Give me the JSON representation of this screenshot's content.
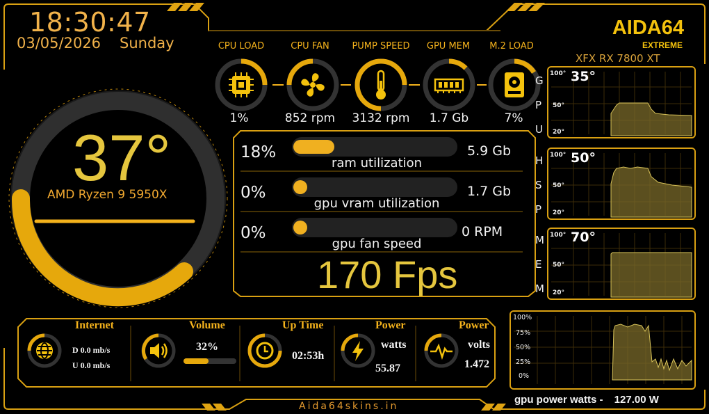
{
  "header": {
    "time": "18:30:47",
    "date": "03/05/2026",
    "day": "Sunday",
    "brand": "AIDA64",
    "brand_sub": "EXTREME",
    "gpu_name": "XFX RX 7800 XT"
  },
  "cpu": {
    "temp": "37°",
    "name": "AMD Ryzen 9 5950X",
    "ring_fraction": 0.55
  },
  "gauges": [
    {
      "label": "CPU LOAD",
      "value": "1%",
      "icon": "cpu-chip-icon",
      "fraction": 0.05
    },
    {
      "label": "CPU FAN",
      "value": "852 rpm",
      "icon": "fan-icon",
      "fraction": 0.25
    },
    {
      "label": "PUMP SPEED",
      "value": "3132 rpm",
      "icon": "thermometer-icon",
      "fraction": 0.75
    },
    {
      "label": "GPU MEM",
      "value": "1.7 Gb",
      "icon": "memory-module-icon",
      "fraction": 0.12
    },
    {
      "label": "M.2 LOAD",
      "value": "7%",
      "icon": "hard-drive-icon",
      "fraction": 0.08
    }
  ],
  "bars": [
    {
      "pct": "18%",
      "value": "5.9 Gb",
      "caption": "ram utilization",
      "fraction": 0.18
    },
    {
      "pct": "0%",
      "value": "1.7 Gb",
      "caption": "gpu vram utilization",
      "fraction": 0.0
    },
    {
      "pct": "0%",
      "value": "0 RPM",
      "caption": "gpu fan speed",
      "fraction": 0.0
    }
  ],
  "fps": "170 Fps",
  "side_labels": {
    "gpu": [
      "G",
      "P",
      "U"
    ],
    "hsp": [
      "H",
      "S",
      "P"
    ],
    "mem": [
      "M",
      "E",
      "M"
    ]
  },
  "graphs": [
    {
      "value": "35°",
      "ticks": [
        "100°",
        "50°",
        "20°"
      ]
    },
    {
      "value": "50°",
      "ticks": [
        "100°",
        "50°",
        "20°"
      ]
    },
    {
      "value": "70°",
      "ticks": [
        "100°",
        "50°",
        "20°"
      ]
    }
  ],
  "bottom": {
    "internet": {
      "title": "Internet",
      "down": "D 0.0 mb/s",
      "up": "U 0.0 mb/s"
    },
    "volume": {
      "title": "Volume",
      "value": "32%",
      "fraction": 0.32
    },
    "uptime": {
      "title": "Up Time",
      "value": "02:53h"
    },
    "power_watts": {
      "title": "Power",
      "label": "watts",
      "value": "55.87"
    },
    "power_volts": {
      "title": "Power",
      "label": "volts",
      "value": "1.472"
    }
  },
  "gpu_power": {
    "ticks": [
      "100%",
      "75%",
      "50%",
      "25%",
      "0%"
    ],
    "caption": "gpu power watts -",
    "value": "127.00 W"
  },
  "footer": "Aida64skins.in",
  "colors": {
    "accent": "#f4b21c",
    "dark_ring": "#3a3a3a",
    "frame": "#d9a012"
  }
}
